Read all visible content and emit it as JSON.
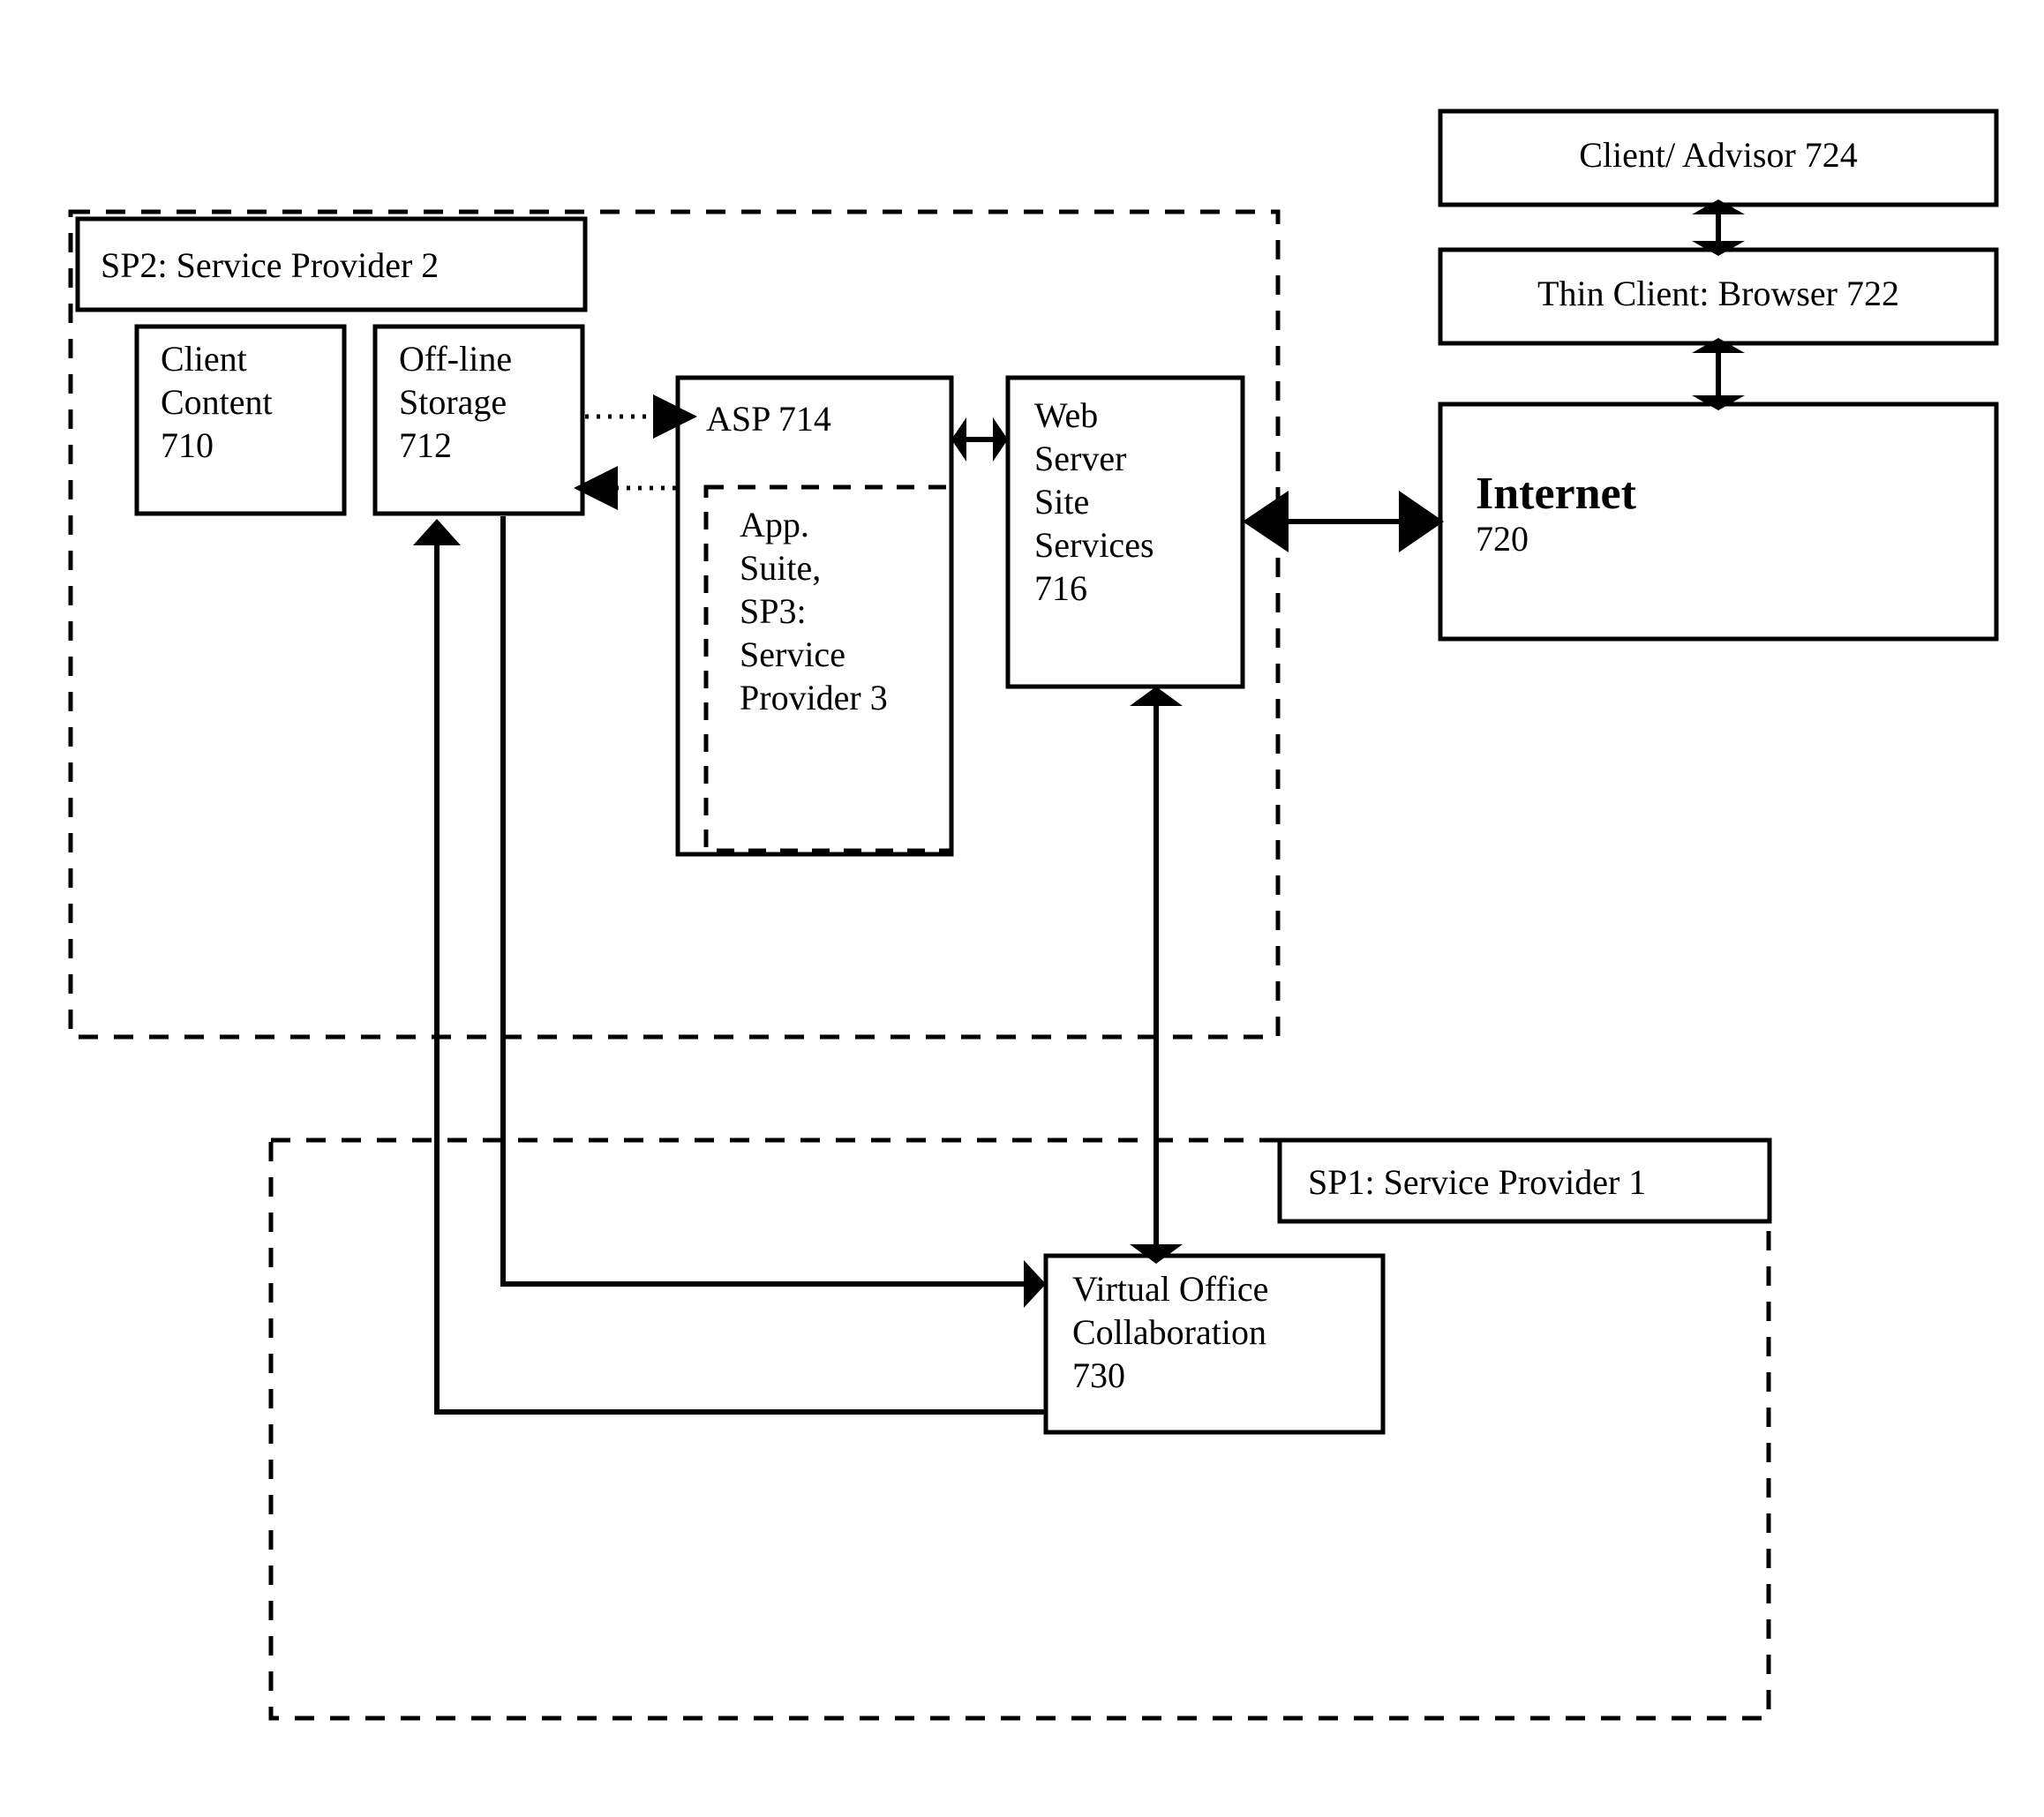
{
  "figure": {
    "kind": "patent-block-diagram",
    "background_color": "#ffffff",
    "line_color": "#000000"
  },
  "regions": {
    "sp2": {
      "title": "SP2: Service Provider 2",
      "border_style": "dashed"
    },
    "sp1": {
      "title": "SP1: Service Provider 1",
      "border_style": "dashed"
    }
  },
  "blocks": {
    "client_content": {
      "label": "Client\nContent\n710",
      "ref": "710"
    },
    "offline_storage": {
      "label": "Off-line\nStorage\n712",
      "ref": "712"
    },
    "asp": {
      "label": "ASP 714",
      "ref": "714"
    },
    "app_suite": {
      "label": "App.\nSuite,\nSP3:\nService\nProvider 3",
      "ref": "SP3",
      "border_style": "dashed"
    },
    "web_server": {
      "label": "Web\nServer\nSite\nServices\n716",
      "ref": "716"
    },
    "internet": {
      "label": "Internet",
      "ref": "720"
    },
    "thin_client": {
      "label": "Thin Client: Browser 722",
      "ref": "722"
    },
    "client_advisor": {
      "label": "Client/ Advisor 724",
      "ref": "724"
    },
    "virtual_office": {
      "label": "Virtual Office\nCollaboration\n730",
      "ref": "730"
    }
  },
  "connections": [
    {
      "id": "storage-to-asp",
      "from": "offline_storage",
      "to": "asp",
      "style": "dotted",
      "direction": "forward"
    },
    {
      "id": "asp-to-storage",
      "from": "asp",
      "to": "offline_storage",
      "style": "dotted",
      "direction": "forward"
    },
    {
      "id": "asp-webserver",
      "from": "asp",
      "to": "web_server",
      "style": "solid",
      "direction": "bidirectional"
    },
    {
      "id": "webserver-internet",
      "from": "web_server",
      "to": "internet",
      "style": "solid",
      "direction": "bidirectional"
    },
    {
      "id": "internet-thinclient",
      "from": "internet",
      "to": "thin_client",
      "style": "solid",
      "direction": "bidirectional"
    },
    {
      "id": "thinclient-clientadvisor",
      "from": "thin_client",
      "to": "client_advisor",
      "style": "solid",
      "direction": "bidirectional"
    },
    {
      "id": "webserver-virtualoffice",
      "from": "web_server",
      "to": "virtual_office",
      "style": "solid",
      "direction": "bidirectional"
    },
    {
      "id": "storage-to-virtualoffice",
      "from": "offline_storage",
      "to": "virtual_office",
      "style": "solid",
      "direction": "forward"
    },
    {
      "id": "virtualoffice-to-storage",
      "from": "virtual_office",
      "to": "offline_storage",
      "style": "solid",
      "direction": "forward"
    }
  ]
}
